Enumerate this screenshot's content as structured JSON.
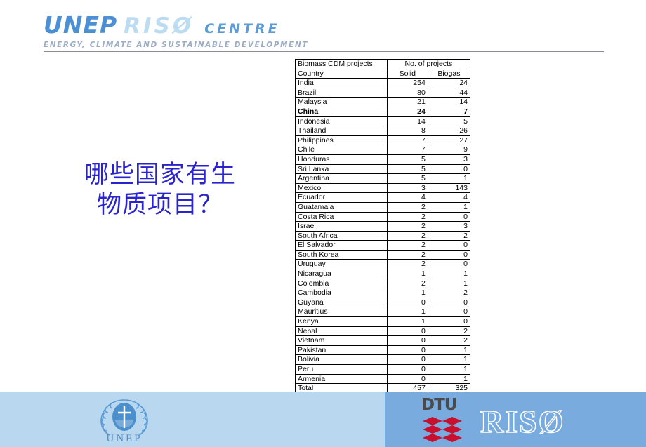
{
  "header": {
    "logo": {
      "unep": "UNEP",
      "riso": "RISØ",
      "centre": "CENTRE",
      "tagline": "ENERGY, CLIMATE AND SUSTAINABLE DEVELOPMENT"
    }
  },
  "slide": {
    "question": "哪些国家有生物质项目？"
  },
  "table": {
    "title": "Biomass CDM projects",
    "group_header": "No. of projects",
    "col_country": "Country",
    "col_solid": "Solid",
    "col_biogas": "Biogas",
    "rows": [
      {
        "country": "India",
        "solid": "254",
        "biogas": "24",
        "bold": false
      },
      {
        "country": "Brazil",
        "solid": "80",
        "biogas": "44",
        "bold": false
      },
      {
        "country": "Malaysia",
        "solid": "21",
        "biogas": "14",
        "bold": false
      },
      {
        "country": "China",
        "solid": "24",
        "biogas": "7",
        "bold": true
      },
      {
        "country": "Indonesia",
        "solid": "14",
        "biogas": "5",
        "bold": false
      },
      {
        "country": "Thailand",
        "solid": "8",
        "biogas": "26",
        "bold": false
      },
      {
        "country": "Philippines",
        "solid": "7",
        "biogas": "27",
        "bold": false
      },
      {
        "country": "Chile",
        "solid": "7",
        "biogas": "9",
        "bold": false
      },
      {
        "country": "Honduras",
        "solid": "5",
        "biogas": "3",
        "bold": false
      },
      {
        "country": "Sri Lanka",
        "solid": "5",
        "biogas": "0",
        "bold": false
      },
      {
        "country": "Argentina",
        "solid": "5",
        "biogas": "1",
        "bold": false
      },
      {
        "country": "Mexico",
        "solid": "3",
        "biogas": "143",
        "bold": false
      },
      {
        "country": "Ecuador",
        "solid": "4",
        "biogas": "4",
        "bold": false
      },
      {
        "country": "Guatamala",
        "solid": "2",
        "biogas": "1",
        "bold": false
      },
      {
        "country": "Costa Rica",
        "solid": "2",
        "biogas": "0",
        "bold": false
      },
      {
        "country": "Israel",
        "solid": "2",
        "biogas": "3",
        "bold": false
      },
      {
        "country": "South Africa",
        "solid": "2",
        "biogas": "2",
        "bold": false
      },
      {
        "country": "El Salvador",
        "solid": "2",
        "biogas": "0",
        "bold": false
      },
      {
        "country": "South Korea",
        "solid": "2",
        "biogas": "0",
        "bold": false
      },
      {
        "country": "Uruguay",
        "solid": "2",
        "biogas": "0",
        "bold": false
      },
      {
        "country": "Nicaragua",
        "solid": "1",
        "biogas": "1",
        "bold": false
      },
      {
        "country": "Colombia",
        "solid": "2",
        "biogas": "1",
        "bold": false
      },
      {
        "country": "Cambodia",
        "solid": "1",
        "biogas": "2",
        "bold": false
      },
      {
        "country": "Guyana",
        "solid": "0",
        "biogas": "0",
        "bold": false
      },
      {
        "country": "Mauritius",
        "solid": "1",
        "biogas": "0",
        "bold": false
      },
      {
        "country": "Kenya",
        "solid": "1",
        "biogas": "0",
        "bold": false
      },
      {
        "country": "Nepal",
        "solid": "0",
        "biogas": "2",
        "bold": false
      },
      {
        "country": "Vietnam",
        "solid": "0",
        "biogas": "2",
        "bold": false
      },
      {
        "country": "Pakistan",
        "solid": "0",
        "biogas": "1",
        "bold": false
      },
      {
        "country": "Bolivia",
        "solid": "0",
        "biogas": "1",
        "bold": false
      },
      {
        "country": "Peru",
        "solid": "0",
        "biogas": "1",
        "bold": false
      },
      {
        "country": "Armenia",
        "solid": "0",
        "biogas": "1",
        "bold": false
      }
    ],
    "total": {
      "label": "Total",
      "solid": "457",
      "biogas": "325"
    }
  },
  "footer": {
    "unep_label": "UNEP",
    "dtu_label": "DTU",
    "riso_label": "RISØ",
    "colors": {
      "band_left": "#b9d7ef",
      "band_right": "#79abdf",
      "unep_blue": "#4b8fcc",
      "dtu_gray": "#4a4a4a",
      "dtu_red": "#c8102e"
    }
  }
}
